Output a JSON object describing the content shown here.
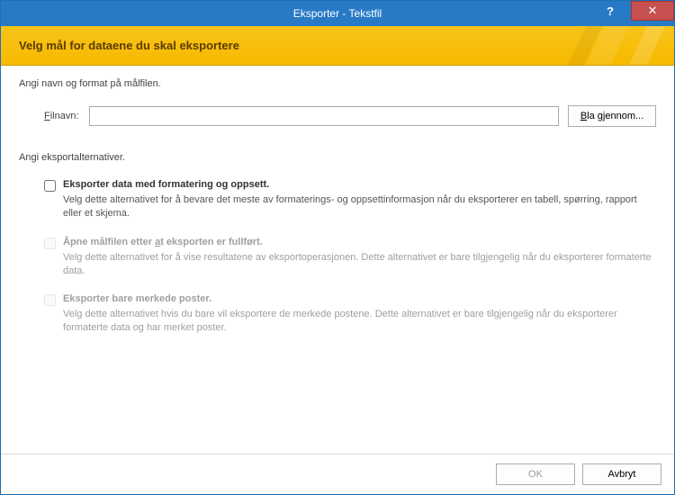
{
  "window": {
    "title": "Eksporter - Tekstfil",
    "help_label": "?",
    "close_label": "✕"
  },
  "header": {
    "heading": "Velg mål for dataene du skal eksportere"
  },
  "dest": {
    "section_label": "Angi navn og format på målfilen.",
    "filename_label_pre": "F",
    "filename_label_post": "ilnavn:",
    "filename_value": "",
    "browse_pre": "B",
    "browse_post": "la gjennom..."
  },
  "options_section_label": "Angi eksportalternativer.",
  "options": {
    "opt1": {
      "title": "Eksporter data med formatering og oppsett.",
      "desc": "Velg dette alternativet for å bevare det meste av formaterings- og oppsettinformasjon når du eksporterer en tabell, spørring, rapport eller et skjema.",
      "checked": false,
      "enabled": true
    },
    "opt2": {
      "title_pre": "Åpne målfilen etter ",
      "title_ul": "a",
      "title_post": "t eksporten er fullført.",
      "desc": "Velg dette alternativet for å vise resultatene av eksportoperasjonen. Dette alternativet er bare tilgjengelig når du eksporterer formaterte data.",
      "checked": false,
      "enabled": false
    },
    "opt3": {
      "title": "Eksporter bare merkede poster.",
      "desc": "Velg dette alternativet hvis du bare vil eksportere de merkede postene. Dette alternativet er bare tilgjengelig når du eksporterer formaterte data og har merket poster.",
      "checked": false,
      "enabled": false
    }
  },
  "footer": {
    "ok_label": "OK",
    "cancel_label": "Avbryt"
  }
}
